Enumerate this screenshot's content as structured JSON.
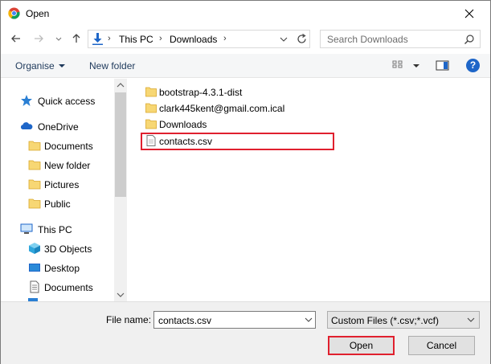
{
  "window": {
    "title": "Open"
  },
  "address": {
    "segments": [
      "This PC",
      "Downloads"
    ]
  },
  "search": {
    "placeholder": "Search Downloads"
  },
  "toolbar": {
    "organise_label": "Organise",
    "new_folder_label": "New folder",
    "help_label": "?"
  },
  "nav": {
    "items": [
      {
        "label": "Quick access",
        "icon": "star-icon"
      },
      {
        "label": "OneDrive",
        "icon": "cloud-icon"
      },
      {
        "label": "Documents",
        "icon": "folder-icon"
      },
      {
        "label": "New folder",
        "icon": "folder-icon"
      },
      {
        "label": "Pictures",
        "icon": "folder-icon"
      },
      {
        "label": "Public",
        "icon": "folder-icon"
      },
      {
        "label": "This PC",
        "icon": "computer-icon"
      },
      {
        "label": "3D Objects",
        "icon": "cube-icon"
      },
      {
        "label": "Desktop",
        "icon": "desktop-icon"
      },
      {
        "label": "Documents",
        "icon": "documents-icon"
      }
    ]
  },
  "files": [
    {
      "name": "bootstrap-4.3.1-dist",
      "type": "folder"
    },
    {
      "name": "clark445kent@gmail.com.ical",
      "type": "folder"
    },
    {
      "name": "Downloads",
      "type": "folder"
    },
    {
      "name": "contacts.csv",
      "type": "file"
    }
  ],
  "bottom": {
    "file_name_label": "File name:",
    "file_name_value": "contacts.csv",
    "file_type_value": "Custom Files (*.csv;*.vcf)",
    "open_label": "Open",
    "cancel_label": "Cancel"
  },
  "colors": {
    "highlight": "#e0202e",
    "accent": "#1e66c8",
    "folder": "#f7d774"
  }
}
